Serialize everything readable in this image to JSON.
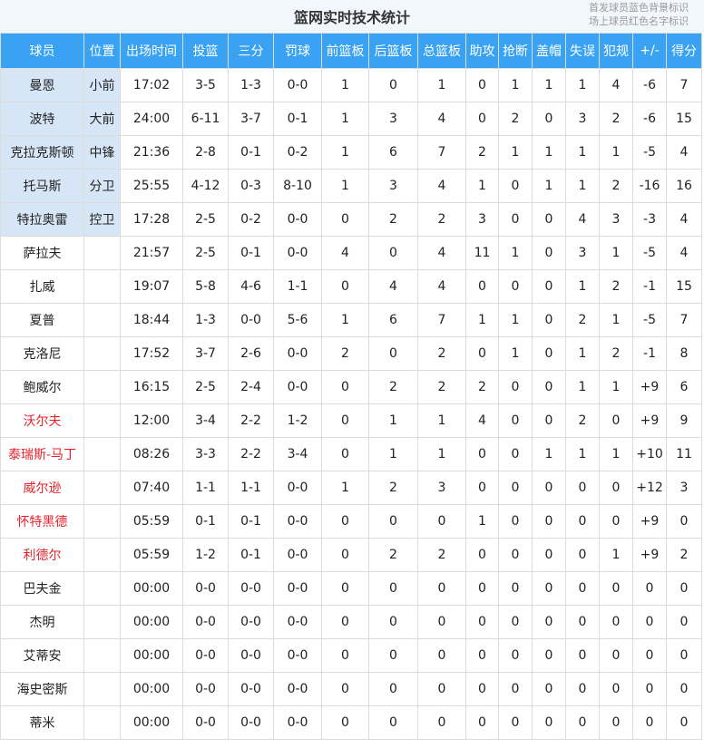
{
  "header": {
    "title": "篮网实时技术统计",
    "legend_starter": "首发球员蓝色背景标识",
    "legend_oncourt": "场上球员红色名字标识"
  },
  "columns": [
    "球员",
    "位置",
    "出场时间",
    "投篮",
    "三分",
    "罚球",
    "前篮板",
    "后篮板",
    "总篮板",
    "助攻",
    "抢断",
    "盖帽",
    "失误",
    "犯规",
    "+/-",
    "得分"
  ],
  "colors": {
    "header_bg": "#39a2f2",
    "starter_bg": "#d6e6f6",
    "oncourt_name": "#e8222b"
  },
  "players": [
    {
      "name": "曼恩",
      "pos": "小前",
      "min": "17:02",
      "fg": "3-5",
      "three": "1-3",
      "ft": "0-0",
      "oreb": "1",
      "dreb": "0",
      "reb": "1",
      "ast": "0",
      "stl": "1",
      "blk": "1",
      "tov": "1",
      "pf": "4",
      "pm": "-6",
      "pts": "7",
      "starter": true,
      "oncourt": false
    },
    {
      "name": "波特",
      "pos": "大前",
      "min": "24:00",
      "fg": "6-11",
      "three": "3-7",
      "ft": "0-1",
      "oreb": "1",
      "dreb": "3",
      "reb": "4",
      "ast": "0",
      "stl": "2",
      "blk": "0",
      "tov": "3",
      "pf": "2",
      "pm": "-6",
      "pts": "15",
      "starter": true,
      "oncourt": false
    },
    {
      "name": "克拉克斯顿",
      "pos": "中锋",
      "min": "21:36",
      "fg": "2-8",
      "three": "0-1",
      "ft": "0-2",
      "oreb": "1",
      "dreb": "6",
      "reb": "7",
      "ast": "2",
      "stl": "1",
      "blk": "1",
      "tov": "1",
      "pf": "1",
      "pm": "-5",
      "pts": "4",
      "starter": true,
      "oncourt": false
    },
    {
      "name": "托马斯",
      "pos": "分卫",
      "min": "25:55",
      "fg": "4-12",
      "three": "0-3",
      "ft": "8-10",
      "oreb": "1",
      "dreb": "3",
      "reb": "4",
      "ast": "1",
      "stl": "0",
      "blk": "1",
      "tov": "1",
      "pf": "2",
      "pm": "-16",
      "pts": "16",
      "starter": true,
      "oncourt": false
    },
    {
      "name": "特拉奥雷",
      "pos": "控卫",
      "min": "17:28",
      "fg": "2-5",
      "three": "0-2",
      "ft": "0-0",
      "oreb": "0",
      "dreb": "2",
      "reb": "2",
      "ast": "3",
      "stl": "0",
      "blk": "0",
      "tov": "4",
      "pf": "3",
      "pm": "-3",
      "pts": "4",
      "starter": true,
      "oncourt": false
    },
    {
      "name": "萨拉夫",
      "pos": "",
      "min": "21:57",
      "fg": "2-5",
      "three": "0-1",
      "ft": "0-0",
      "oreb": "4",
      "dreb": "0",
      "reb": "4",
      "ast": "11",
      "stl": "1",
      "blk": "0",
      "tov": "3",
      "pf": "1",
      "pm": "-5",
      "pts": "4",
      "starter": false,
      "oncourt": false
    },
    {
      "name": "扎威",
      "pos": "",
      "min": "19:07",
      "fg": "5-8",
      "three": "4-6",
      "ft": "1-1",
      "oreb": "0",
      "dreb": "4",
      "reb": "4",
      "ast": "0",
      "stl": "0",
      "blk": "0",
      "tov": "1",
      "pf": "2",
      "pm": "-1",
      "pts": "15",
      "starter": false,
      "oncourt": false
    },
    {
      "name": "夏普",
      "pos": "",
      "min": "18:44",
      "fg": "1-3",
      "three": "0-0",
      "ft": "5-6",
      "oreb": "1",
      "dreb": "6",
      "reb": "7",
      "ast": "1",
      "stl": "1",
      "blk": "0",
      "tov": "2",
      "pf": "1",
      "pm": "-5",
      "pts": "7",
      "starter": false,
      "oncourt": false
    },
    {
      "name": "克洛尼",
      "pos": "",
      "min": "17:52",
      "fg": "3-7",
      "three": "2-6",
      "ft": "0-0",
      "oreb": "2",
      "dreb": "0",
      "reb": "2",
      "ast": "0",
      "stl": "1",
      "blk": "0",
      "tov": "1",
      "pf": "2",
      "pm": "-1",
      "pts": "8",
      "starter": false,
      "oncourt": false
    },
    {
      "name": "鲍威尔",
      "pos": "",
      "min": "16:15",
      "fg": "2-5",
      "three": "2-4",
      "ft": "0-0",
      "oreb": "0",
      "dreb": "2",
      "reb": "2",
      "ast": "2",
      "stl": "0",
      "blk": "0",
      "tov": "1",
      "pf": "1",
      "pm": "+9",
      "pts": "6",
      "starter": false,
      "oncourt": false
    },
    {
      "name": "沃尔夫",
      "pos": "",
      "min": "12:00",
      "fg": "3-4",
      "three": "2-2",
      "ft": "1-2",
      "oreb": "0",
      "dreb": "1",
      "reb": "1",
      "ast": "4",
      "stl": "0",
      "blk": "0",
      "tov": "2",
      "pf": "0",
      "pm": "+9",
      "pts": "9",
      "starter": false,
      "oncourt": true
    },
    {
      "name": "泰瑞斯-马丁",
      "pos": "",
      "min": "08:26",
      "fg": "3-3",
      "three": "2-2",
      "ft": "3-4",
      "oreb": "0",
      "dreb": "1",
      "reb": "1",
      "ast": "0",
      "stl": "0",
      "blk": "1",
      "tov": "1",
      "pf": "1",
      "pm": "+10",
      "pts": "11",
      "starter": false,
      "oncourt": true
    },
    {
      "name": "威尔逊",
      "pos": "",
      "min": "07:40",
      "fg": "1-1",
      "three": "1-1",
      "ft": "0-0",
      "oreb": "1",
      "dreb": "2",
      "reb": "3",
      "ast": "0",
      "stl": "0",
      "blk": "0",
      "tov": "0",
      "pf": "0",
      "pm": "+12",
      "pts": "3",
      "starter": false,
      "oncourt": true
    },
    {
      "name": "怀特黑德",
      "pos": "",
      "min": "05:59",
      "fg": "0-1",
      "three": "0-1",
      "ft": "0-0",
      "oreb": "0",
      "dreb": "0",
      "reb": "0",
      "ast": "1",
      "stl": "0",
      "blk": "0",
      "tov": "0",
      "pf": "0",
      "pm": "+9",
      "pts": "0",
      "starter": false,
      "oncourt": true
    },
    {
      "name": "利德尔",
      "pos": "",
      "min": "05:59",
      "fg": "1-2",
      "three": "0-1",
      "ft": "0-0",
      "oreb": "0",
      "dreb": "2",
      "reb": "2",
      "ast": "0",
      "stl": "0",
      "blk": "0",
      "tov": "0",
      "pf": "1",
      "pm": "+9",
      "pts": "2",
      "starter": false,
      "oncourt": true
    },
    {
      "name": "巴夫金",
      "pos": "",
      "min": "00:00",
      "fg": "0-0",
      "three": "0-0",
      "ft": "0-0",
      "oreb": "0",
      "dreb": "0",
      "reb": "0",
      "ast": "0",
      "stl": "0",
      "blk": "0",
      "tov": "0",
      "pf": "0",
      "pm": "0",
      "pts": "0",
      "starter": false,
      "oncourt": false
    },
    {
      "name": "杰明",
      "pos": "",
      "min": "00:00",
      "fg": "0-0",
      "three": "0-0",
      "ft": "0-0",
      "oreb": "0",
      "dreb": "0",
      "reb": "0",
      "ast": "0",
      "stl": "0",
      "blk": "0",
      "tov": "0",
      "pf": "0",
      "pm": "0",
      "pts": "0",
      "starter": false,
      "oncourt": false
    },
    {
      "name": "艾蒂安",
      "pos": "",
      "min": "00:00",
      "fg": "0-0",
      "three": "0-0",
      "ft": "0-0",
      "oreb": "0",
      "dreb": "0",
      "reb": "0",
      "ast": "0",
      "stl": "0",
      "blk": "0",
      "tov": "0",
      "pf": "0",
      "pm": "0",
      "pts": "0",
      "starter": false,
      "oncourt": false
    },
    {
      "name": "海史密斯",
      "pos": "",
      "min": "00:00",
      "fg": "0-0",
      "three": "0-0",
      "ft": "0-0",
      "oreb": "0",
      "dreb": "0",
      "reb": "0",
      "ast": "0",
      "stl": "0",
      "blk": "0",
      "tov": "0",
      "pf": "0",
      "pm": "0",
      "pts": "0",
      "starter": false,
      "oncourt": false
    },
    {
      "name": "蒂米",
      "pos": "",
      "min": "00:00",
      "fg": "0-0",
      "three": "0-0",
      "ft": "0-0",
      "oreb": "0",
      "dreb": "0",
      "reb": "0",
      "ast": "0",
      "stl": "0",
      "blk": "0",
      "tov": "0",
      "pf": "0",
      "pm": "0",
      "pts": "0",
      "starter": false,
      "oncourt": false
    }
  ]
}
